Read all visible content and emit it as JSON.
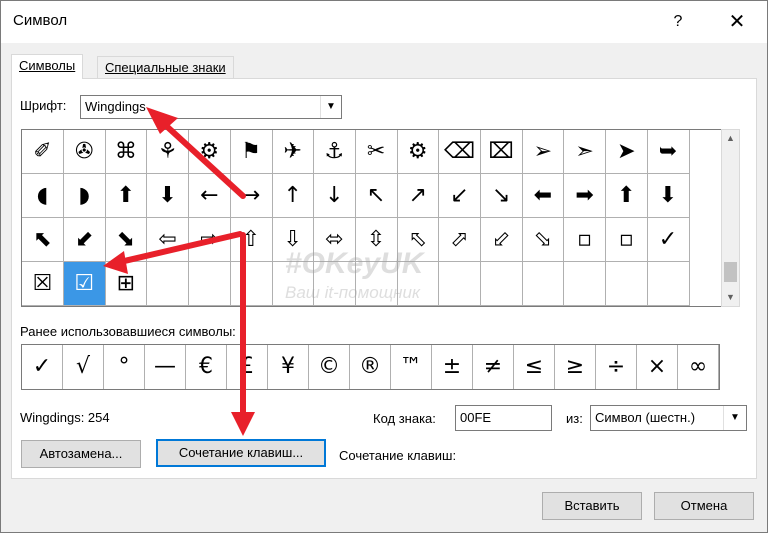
{
  "window": {
    "title": "Символ",
    "help": "?",
    "close": "✕"
  },
  "tabs": [
    {
      "label": "Символы",
      "active": true
    },
    {
      "label": "Специальные знаки",
      "active": false
    }
  ],
  "font": {
    "label": "Шрифт:",
    "value": "Wingdings"
  },
  "symbol_grid": {
    "rows": [
      [
        "✐",
        "✇",
        "⌘",
        "⚘",
        "⚙",
        "⚑",
        "✈",
        "⚓",
        "✂",
        "⚙",
        "⌫",
        "⌧",
        "➢",
        "➣",
        "➤",
        "➥"
      ],
      [
        "◖",
        "◗",
        "⬆",
        "⬇",
        "←",
        "→",
        "↑",
        "↓",
        "↖",
        "↗",
        "↙",
        "↘",
        "⬅",
        "➡",
        "⬆",
        "⬇"
      ],
      [
        "⬉",
        "⬋",
        "⬊",
        "⇦",
        "⇨",
        "⇧",
        "⇩",
        "⬄",
        "⇳",
        "⬁",
        "⬀",
        "⬃",
        "⬂",
        "▫",
        "▫",
        "✕"
      ],
      [
        "☒",
        "☑",
        "⊞",
        "",
        "",
        "",
        "",
        "",
        "",
        "",
        "",
        "",
        "",
        "",
        "",
        ""
      ]
    ],
    "selected": "☑",
    "row3_extra": "✓"
  },
  "recent": {
    "label": "Ранее использовавшиеся символы:",
    "symbols": [
      "✓",
      "√",
      "°",
      "—",
      "€",
      "£",
      "¥",
      "©",
      "®",
      "™",
      "±",
      "≠",
      "≤",
      "≥",
      "÷",
      "×",
      "∞"
    ]
  },
  "info": {
    "font_code": "Wingdings: 254"
  },
  "code": {
    "label": "Код знака:",
    "value": "00FE"
  },
  "from": {
    "label": "из:",
    "value": "Символ (шестн.)"
  },
  "buttons": {
    "autocorrect": "Автозамена...",
    "shortcut_key": "Сочетание клавиш...",
    "insert": "Вставить",
    "cancel": "Отмена"
  },
  "shortcut": {
    "label": "Сочетание клавиш:"
  },
  "watermark": {
    "line1": "#OKeyUK",
    "line2": "Ваш it-помощник"
  },
  "colors": {
    "accent": "#0078d7",
    "selection": "#3b97e6",
    "annotation_arrow": "#e8202a"
  }
}
